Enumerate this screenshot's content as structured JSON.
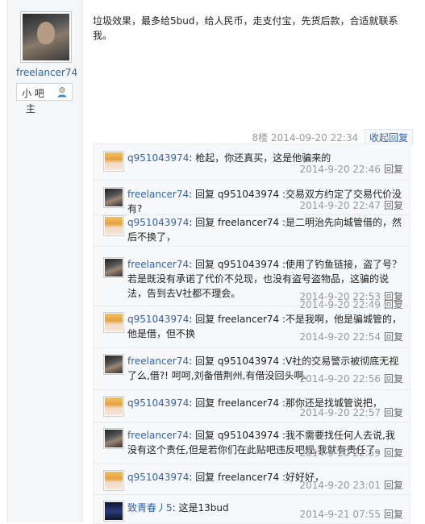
{
  "author": {
    "name": "freelancer74",
    "badge_label": "小 吧",
    "badge_sub": "主"
  },
  "post": {
    "text": "垃圾效果，最多给5bud，给人民币，走支付宝，先货后款，合适就联系我。",
    "floor": "8楼",
    "time": "2014-09-20 22:34",
    "collapse_label": "收起回复"
  },
  "reply_label": "回复",
  "replies": [
    {
      "user": "q951043974",
      "avatar": "girl",
      "text": ": 枪起，你还真买，这是他骗来的",
      "time": "2014-9-20 22:46"
    },
    {
      "user": "freelancer74",
      "avatar": "man",
      "text": ": 回复 q951043974 :交易双方约定了交易代价没有?",
      "time": "2014-9-20 22:47"
    },
    {
      "user": "q951043974",
      "avatar": "girl",
      "text": ": 回复 freelancer74 :是二明治先向城管借的，然后不换了，",
      "time": "2014-9-20 22:49"
    },
    {
      "user": "freelancer74",
      "avatar": "man",
      "text": ": 回复 q951043974 :使用了钓鱼链接，盗了号？若是既没有承诺了代价不兑现，也没有盗号盗物品，这骗的说法，告到去V社都不理会。",
      "time": "2014-9-20 22:53"
    },
    {
      "user": "q951043974",
      "avatar": "girl",
      "text": ": 回复 freelancer74 :不是我啊，他是骗城管的，他是借，但不换",
      "time": "2014-9-20 22:54"
    },
    {
      "user": "freelancer74",
      "avatar": "man",
      "text": ": 回复 q951043974 :V社的交易警示被彻底无视了么,借?! 呵呵,刘备借荆州,有借没回头啊.",
      "time": "2014-9-20 22:56"
    },
    {
      "user": "q951043974",
      "avatar": "girl",
      "text": ": 回复 freelancer74 :那你还是找城管说把，",
      "time": "2014-9-20 22:57"
    },
    {
      "user": "freelancer74",
      "avatar": "man",
      "text": ": 回复 q951043974 :我不需要找任何人去说,我没有这个责任,但是若你们在此贴吧违反吧规,我就有责任了。",
      "time": "2014-9-20 22:59"
    },
    {
      "user": "q951043974",
      "avatar": "girl",
      "text": ": 回复 freelancer74 :好好好，",
      "time": "2014-9-20 23:01"
    },
    {
      "user": "致青春丿5",
      "avatar": "dark",
      "text": ": 这是13bud",
      "time": "2014-9-21 07:55"
    }
  ]
}
